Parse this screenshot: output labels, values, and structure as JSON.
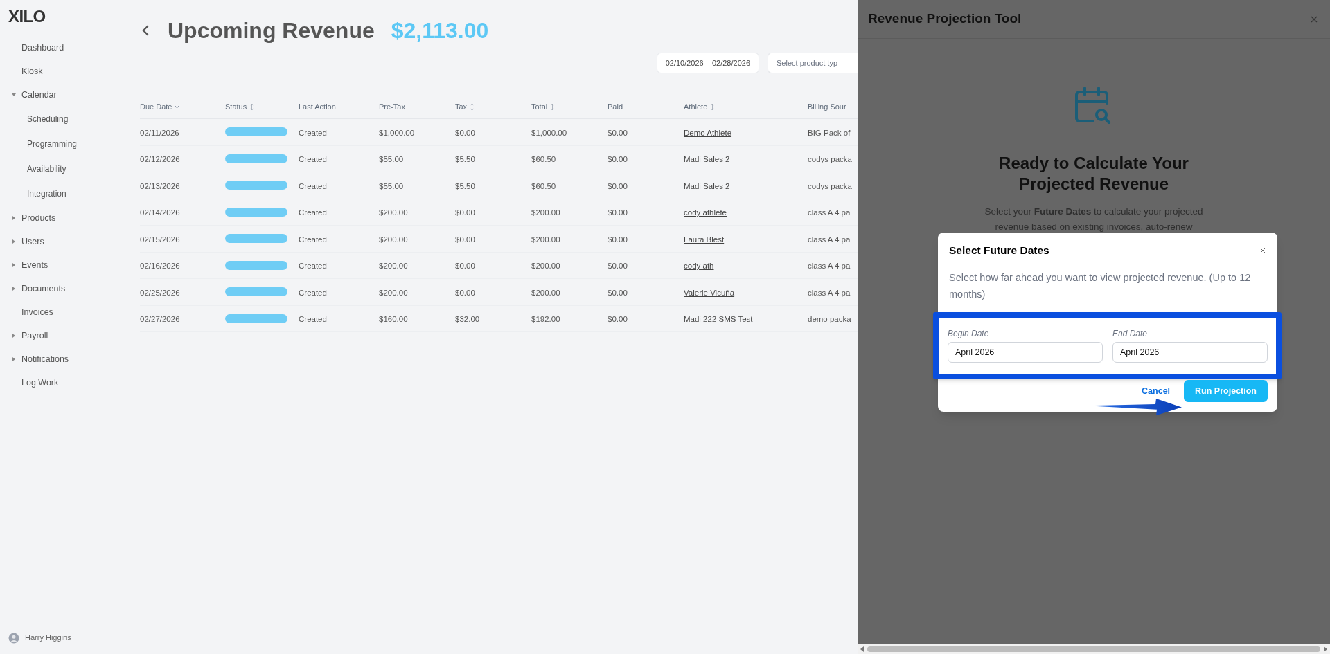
{
  "sidebar": {
    "logo": "XILO",
    "items": [
      {
        "label": "Dashboard",
        "kind": "link"
      },
      {
        "label": "Kiosk",
        "kind": "link"
      },
      {
        "label": "Calendar",
        "kind": "group",
        "expanded": true,
        "children": [
          {
            "label": "Scheduling"
          },
          {
            "label": "Programming"
          },
          {
            "label": "Availability"
          },
          {
            "label": "Integration"
          }
        ]
      },
      {
        "label": "Products",
        "kind": "group",
        "expanded": false
      },
      {
        "label": "Users",
        "kind": "group",
        "expanded": false
      },
      {
        "label": "Events",
        "kind": "group",
        "expanded": false
      },
      {
        "label": "Documents",
        "kind": "group",
        "expanded": false
      },
      {
        "label": "Invoices",
        "kind": "link"
      },
      {
        "label": "Payroll",
        "kind": "group",
        "expanded": false
      },
      {
        "label": "Notifications",
        "kind": "group",
        "expanded": false
      },
      {
        "label": "Log Work",
        "kind": "link"
      }
    ],
    "user": "Harry Higgins"
  },
  "page": {
    "title": "Upcoming Revenue",
    "total": "$2,113.00",
    "date_range": "02/10/2026 – 02/28/2026",
    "product_filter": {
      "placeholder": "Select product typ"
    }
  },
  "table": {
    "columns": [
      {
        "label": "Due Date",
        "kind": "sorted"
      },
      {
        "label": "Status",
        "kind": "sortable"
      },
      {
        "label": "Last Action",
        "kind": "plain"
      },
      {
        "label": "Pre-Tax",
        "kind": "plain"
      },
      {
        "label": "Tax",
        "kind": "sortable"
      },
      {
        "label": "Total",
        "kind": "sortable"
      },
      {
        "label": "Paid",
        "kind": "plain"
      },
      {
        "label": "Athlete",
        "kind": "sortable"
      },
      {
        "label": "Billing Sour",
        "kind": "plain"
      }
    ],
    "rows": [
      {
        "due_date": "02/11/2026",
        "last_action": "Created",
        "pre_tax": "$1,000.00",
        "tax": "$0.00",
        "total": "$1,000.00",
        "paid": "$0.00",
        "athlete": "Demo Athlete",
        "billing_source": "BIG Pack of"
      },
      {
        "due_date": "02/12/2026",
        "last_action": "Created",
        "pre_tax": "$55.00",
        "tax": "$5.50",
        "total": "$60.50",
        "paid": "$0.00",
        "athlete": "Madi Sales 2",
        "billing_source": "codys packa"
      },
      {
        "due_date": "02/13/2026",
        "last_action": "Created",
        "pre_tax": "$55.00",
        "tax": "$5.50",
        "total": "$60.50",
        "paid": "$0.00",
        "athlete": "Madi Sales 2",
        "billing_source": "codys packa"
      },
      {
        "due_date": "02/14/2026",
        "last_action": "Created",
        "pre_tax": "$200.00",
        "tax": "$0.00",
        "total": "$200.00",
        "paid": "$0.00",
        "athlete": "cody athlete",
        "billing_source": "class A 4 pa"
      },
      {
        "due_date": "02/15/2026",
        "last_action": "Created",
        "pre_tax": "$200.00",
        "tax": "$0.00",
        "total": "$200.00",
        "paid": "$0.00",
        "athlete": "Laura Blest",
        "billing_source": "class A 4 pa"
      },
      {
        "due_date": "02/16/2026",
        "last_action": "Created",
        "pre_tax": "$200.00",
        "tax": "$0.00",
        "total": "$200.00",
        "paid": "$0.00",
        "athlete": "cody ath",
        "billing_source": "class A 4 pa"
      },
      {
        "due_date": "02/25/2026",
        "last_action": "Created",
        "pre_tax": "$200.00",
        "tax": "$0.00",
        "total": "$200.00",
        "paid": "$0.00",
        "athlete": "Valerie Vicuña",
        "billing_source": "class A 4 pa"
      },
      {
        "due_date": "02/27/2026",
        "last_action": "Created",
        "pre_tax": "$160.00",
        "tax": "$32.00",
        "total": "$192.00",
        "paid": "$0.00",
        "athlete": "Madi 222 SMS Test",
        "billing_source": "demo packa"
      }
    ]
  },
  "panel": {
    "title": "Revenue Projection Tool",
    "heading": "Ready to Calculate Your Projected Revenue",
    "text": "Select your **Future Dates** to calculate your projected revenue based on existing invoices, auto-renew"
  },
  "dialog": {
    "title": "Select Future Dates",
    "description": "Select how far ahead you want to view projected revenue. (Up to 12 months)",
    "fields": [
      {
        "label": "Begin Date",
        "value": "April 2026"
      },
      {
        "label": "End Date",
        "value": "April 2026"
      }
    ],
    "buttons": [
      {
        "label": "Cancel",
        "kind": "secondary"
      },
      {
        "label": "Run Projection",
        "kind": "primary"
      }
    ]
  }
}
